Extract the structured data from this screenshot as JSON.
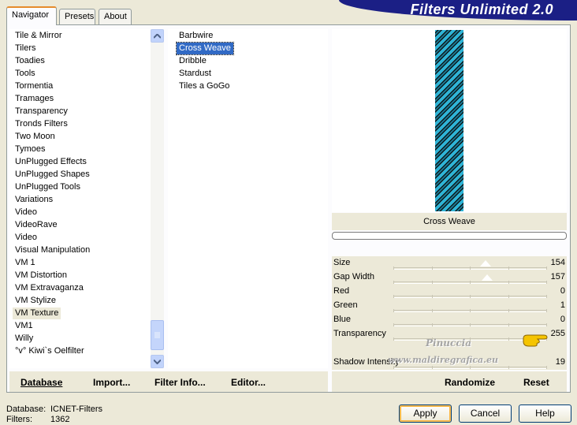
{
  "tabs": [
    {
      "label": "Navigator",
      "active": true
    },
    {
      "label": "Presets",
      "active": false
    },
    {
      "label": "About",
      "active": false
    }
  ],
  "banner": {
    "title": "Filters Unlimited 2.0"
  },
  "categories": [
    {
      "label": "Tile & Mirror"
    },
    {
      "label": "Tilers"
    },
    {
      "label": "Toadies"
    },
    {
      "label": "Tools"
    },
    {
      "label": "Tormentia"
    },
    {
      "label": "Tramages"
    },
    {
      "label": "Transparency"
    },
    {
      "label": "Tronds Filters"
    },
    {
      "label": "Two Moon"
    },
    {
      "label": "Tymoes"
    },
    {
      "label": "UnPlugged Effects"
    },
    {
      "label": "UnPlugged Shapes"
    },
    {
      "label": "UnPlugged Tools"
    },
    {
      "label": "Variations"
    },
    {
      "label": "Video"
    },
    {
      "label": "VideoRave"
    },
    {
      "label": "Video"
    },
    {
      "label": "Visual Manipulation"
    },
    {
      "label": "VM 1"
    },
    {
      "label": "VM Distortion"
    },
    {
      "label": "VM Extravaganza"
    },
    {
      "label": "VM Stylize"
    },
    {
      "label": "VM Texture",
      "selected": true
    },
    {
      "label": "VM1"
    },
    {
      "label": "Willy"
    },
    {
      "label": "°v° Kiwi`s Oelfilter"
    }
  ],
  "filters": [
    {
      "label": "Barbwire"
    },
    {
      "label": "Cross Weave",
      "selected": true
    },
    {
      "label": "Dribble"
    },
    {
      "label": "Stardust"
    },
    {
      "label": "Tiles a GoGo"
    }
  ],
  "preview": {
    "filter_name": "Cross Weave",
    "pattern_colors": {
      "dark": "#0a0a0a",
      "light": "#2fb4d6",
      "mid": "#1b7a94"
    }
  },
  "params": [
    {
      "label": "Size",
      "value": "154",
      "level": 154
    },
    {
      "label": "Gap Width",
      "value": "157",
      "level": 157
    },
    {
      "label": "Red",
      "value": "0",
      "level": 0
    },
    {
      "label": "Green",
      "value": "1",
      "level": 1
    },
    {
      "label": "Blue",
      "value": "0",
      "level": 0
    },
    {
      "label": "Transparency",
      "value": "255",
      "level": 255
    },
    {
      "label": "Shadow Intensity",
      "value": "19",
      "level": 19
    }
  ],
  "watermark": {
    "line1": "Pinuccia",
    "line2": "www.maldiregrafica.eu"
  },
  "bottom_left": {
    "database": "Database",
    "import": "Import...",
    "filter_info": "Filter Info...",
    "editor": "Editor..."
  },
  "bottom_right": {
    "randomize": "Randomize",
    "reset": "Reset"
  },
  "status": {
    "database_label": "Database:",
    "database_value": "ICNET-Filters",
    "filters_label": "Filters:",
    "filters_value": "1362"
  },
  "dialog_buttons": {
    "apply": "Apply",
    "cancel": "Cancel",
    "help": "Help"
  },
  "colors": {
    "banner": "#1b1f85",
    "selection": "#316ac5",
    "dialog_bg": "#ece9d8",
    "hand_icon": "#f5c400"
  }
}
